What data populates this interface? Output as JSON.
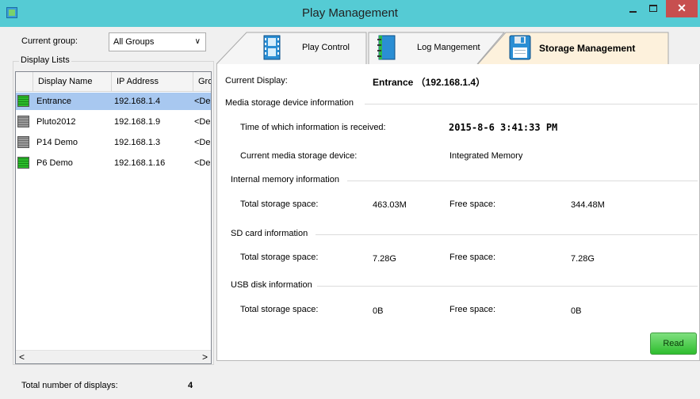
{
  "window": {
    "title": "Play Management"
  },
  "left": {
    "current_group_label": "Current group:",
    "group_select_value": "All Groups",
    "display_lists_label": "Display Lists",
    "columns": [
      "Display Name",
      "IP Address",
      "Gro"
    ],
    "rows": [
      {
        "name": "Entrance",
        "ip": "192.168.1.4",
        "group": "<De",
        "status": "green",
        "selected": true
      },
      {
        "name": "Pluto2012",
        "ip": "192.168.1.9",
        "group": "<De",
        "status": "gray",
        "selected": false
      },
      {
        "name": "P14 Demo",
        "ip": "192.168.1.3",
        "group": "<De",
        "status": "gray",
        "selected": false
      },
      {
        "name": "P6 Demo",
        "ip": "192.168.1.16",
        "group": "<De",
        "status": "green",
        "selected": false
      }
    ],
    "total_label": "Total number of displays:",
    "total_value": "4"
  },
  "tabs": [
    {
      "label": "Play Control",
      "icon": "film-icon",
      "active": false
    },
    {
      "label": "Log Mangement",
      "icon": "notebook-icon",
      "active": false
    },
    {
      "label": "Storage Management",
      "icon": "floppy-disk-icon",
      "active": true
    }
  ],
  "storage": {
    "current_display_label": "Current Display:",
    "current_display_value": "Entrance （192.168.1.4）",
    "media_section": "Media storage device information",
    "time_label": "Time of which information is received:",
    "time_value": "2015-8-6  3:41:33 PM",
    "device_label": "Current media storage device:",
    "device_value": "Integrated Memory",
    "internal_section": "Internal memory information",
    "internal_total_label": "Total storage space:",
    "internal_total_value": "463.03M",
    "internal_free_label": "Free space:",
    "internal_free_value": "344.48M",
    "sd_section": "SD card information",
    "sd_total_label": "Total storage space:",
    "sd_total_value": "7.28G",
    "sd_free_label": "Free space:",
    "sd_free_value": "7.28G",
    "usb_section": "USB disk information",
    "usb_total_label": "Total storage space:",
    "usb_total_value": "0B",
    "usb_free_label": "Free space:",
    "usb_free_value": "0B",
    "read_button": "Read"
  },
  "colors": {
    "titlebar": "#55cbd4",
    "close_button": "#c74f4f",
    "selected_row": "#a8c8f0",
    "active_tab": "#fdf1dc",
    "read_button": "#2ebd2e"
  }
}
